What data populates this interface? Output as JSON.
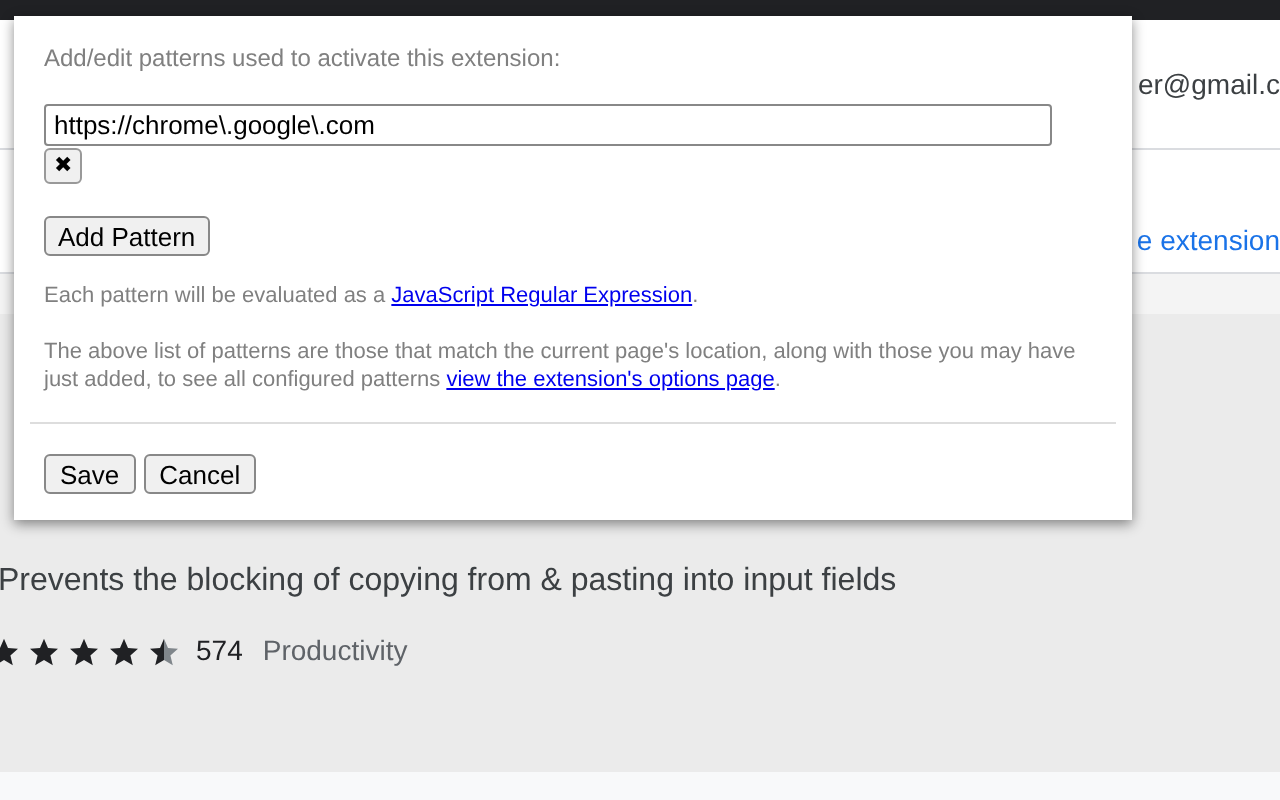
{
  "page": {
    "account": "er@gmail.c",
    "link": "e extension",
    "description": "Prevents the blocking of copying from & pasting into input fields",
    "stars": 4.5,
    "rating_count": "574",
    "category": "Productivity"
  },
  "dialog": {
    "heading": "Add/edit patterns used to activate this extension:",
    "patterns": [
      {
        "value": "https://chrome\\.google\\.com",
        "remove": "✖"
      }
    ],
    "add_button": "Add Pattern",
    "note_prefix": "Each pattern will be evaluated as a ",
    "note_link": "JavaScript Regular Expression",
    "note_suffix": ".",
    "info_prefix": "The above list of patterns are those that match the current page's location, along with those you may have just added, to see all configured patterns ",
    "info_link": "view the extension's options page",
    "info_suffix": ".",
    "buttons": [
      "Save",
      "Cancel"
    ]
  }
}
